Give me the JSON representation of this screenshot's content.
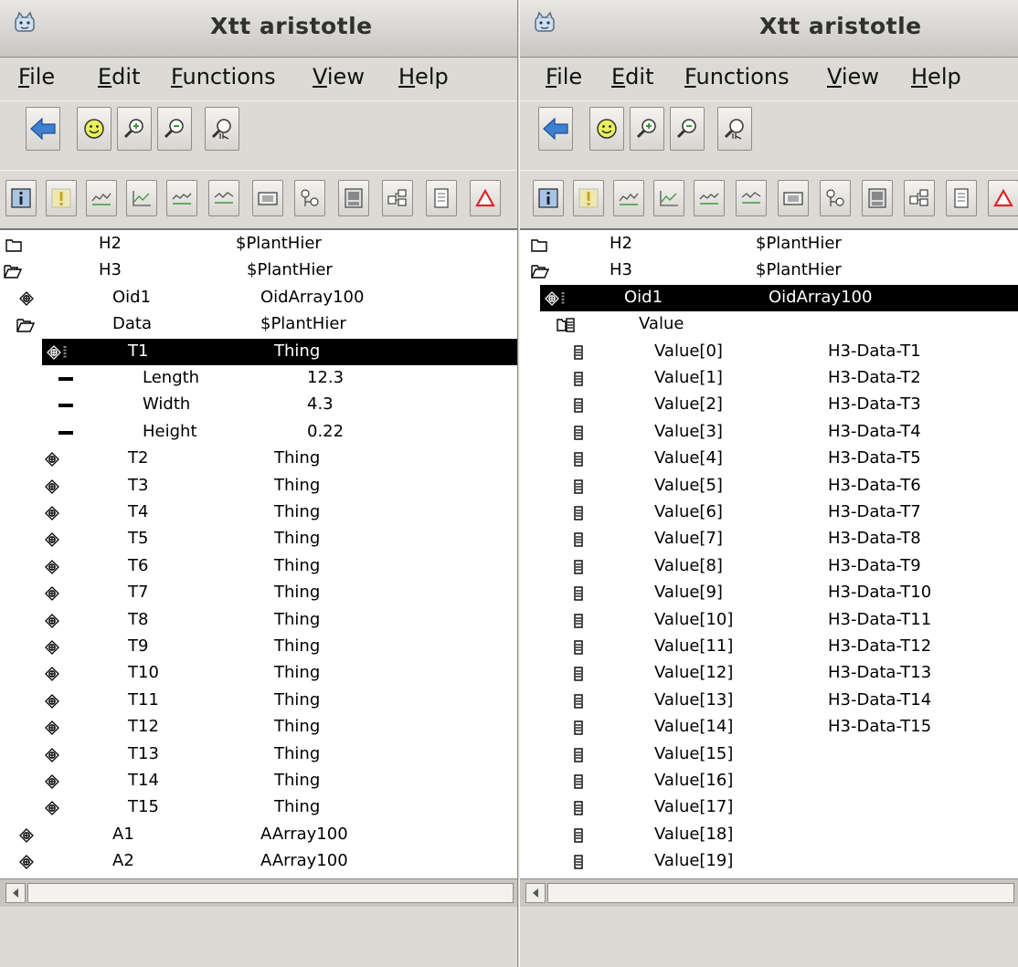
{
  "windows": [
    {
      "title": "Xtt aristotle",
      "menu": [
        {
          "first": "F",
          "rest": "ile"
        },
        {
          "first": "E",
          "rest": "dit"
        },
        {
          "first": "F",
          "rest": "unctions"
        },
        {
          "first": "V",
          "rest": "iew"
        },
        {
          "first": "H",
          "rest": "elp"
        }
      ],
      "rows": [
        {
          "icon": "folder-closed",
          "name": "H2",
          "value": "$PlantHier"
        },
        {
          "icon": "folder-open",
          "name": "H3",
          "value": "$PlantHier"
        },
        {
          "icon": "object",
          "name": "Oid1",
          "value": "OidArray100"
        },
        {
          "icon": "folder-open",
          "name": "Data",
          "value": "$PlantHier"
        },
        {
          "icon": "object-open",
          "name": "T1",
          "value": "Thing",
          "selected": true
        },
        {
          "icon": "attribute",
          "name": "Length",
          "value": "12.3"
        },
        {
          "icon": "attribute",
          "name": "Width",
          "value": "4.3"
        },
        {
          "icon": "attribute",
          "name": "Height",
          "value": "0.22"
        },
        {
          "icon": "object",
          "name": "T2",
          "value": "Thing"
        },
        {
          "icon": "object",
          "name": "T3",
          "value": "Thing"
        },
        {
          "icon": "object",
          "name": "T4",
          "value": "Thing"
        },
        {
          "icon": "object",
          "name": "T5",
          "value": "Thing"
        },
        {
          "icon": "object",
          "name": "T6",
          "value": "Thing"
        },
        {
          "icon": "object",
          "name": "T7",
          "value": "Thing"
        },
        {
          "icon": "object",
          "name": "T8",
          "value": "Thing"
        },
        {
          "icon": "object",
          "name": "T9",
          "value": "Thing"
        },
        {
          "icon": "object",
          "name": "T10",
          "value": "Thing"
        },
        {
          "icon": "object",
          "name": "T11",
          "value": "Thing"
        },
        {
          "icon": "object",
          "name": "T12",
          "value": "Thing"
        },
        {
          "icon": "object",
          "name": "T13",
          "value": "Thing"
        },
        {
          "icon": "object",
          "name": "T14",
          "value": "Thing"
        },
        {
          "icon": "object",
          "name": "T15",
          "value": "Thing"
        },
        {
          "icon": "object",
          "name": "A1",
          "value": "AArray100"
        },
        {
          "icon": "object",
          "name": "A2",
          "value": "AArray100"
        }
      ]
    },
    {
      "title": "Xtt aristotle",
      "menu": [
        {
          "first": "F",
          "rest": "ile"
        },
        {
          "first": "E",
          "rest": "dit"
        },
        {
          "first": "F",
          "rest": "unctions"
        },
        {
          "first": "V",
          "rest": "iew"
        },
        {
          "first": "H",
          "rest": "elp"
        }
      ],
      "rows": [
        {
          "icon": "folder-closed",
          "name": "H2",
          "value": "$PlantHier"
        },
        {
          "icon": "folder-open",
          "name": "H3",
          "value": "$PlantHier"
        },
        {
          "icon": "object-open",
          "name": "Oid1",
          "value": "OidArray100",
          "selected": true
        },
        {
          "icon": "array-open",
          "name": "Value",
          "value": ""
        },
        {
          "icon": "element",
          "name": "Value[0]",
          "value": "H3-Data-T1"
        },
        {
          "icon": "element",
          "name": "Value[1]",
          "value": "H3-Data-T2"
        },
        {
          "icon": "element",
          "name": "Value[2]",
          "value": "H3-Data-T3"
        },
        {
          "icon": "element",
          "name": "Value[3]",
          "value": "H3-Data-T4"
        },
        {
          "icon": "element",
          "name": "Value[4]",
          "value": "H3-Data-T5"
        },
        {
          "icon": "element",
          "name": "Value[5]",
          "value": "H3-Data-T6"
        },
        {
          "icon": "element",
          "name": "Value[6]",
          "value": "H3-Data-T7"
        },
        {
          "icon": "element",
          "name": "Value[7]",
          "value": "H3-Data-T8"
        },
        {
          "icon": "element",
          "name": "Value[8]",
          "value": "H3-Data-T9"
        },
        {
          "icon": "element",
          "name": "Value[9]",
          "value": "H3-Data-T10"
        },
        {
          "icon": "element",
          "name": "Value[10]",
          "value": "H3-Data-T11"
        },
        {
          "icon": "element",
          "name": "Value[11]",
          "value": "H3-Data-T12"
        },
        {
          "icon": "element",
          "name": "Value[12]",
          "value": "H3-Data-T13"
        },
        {
          "icon": "element",
          "name": "Value[13]",
          "value": "H3-Data-T14"
        },
        {
          "icon": "element",
          "name": "Value[14]",
          "value": "H3-Data-T15"
        },
        {
          "icon": "element",
          "name": "Value[15]",
          "value": ""
        },
        {
          "icon": "element",
          "name": "Value[16]",
          "value": ""
        },
        {
          "icon": "element",
          "name": "Value[17]",
          "value": ""
        },
        {
          "icon": "element",
          "name": "Value[18]",
          "value": ""
        },
        {
          "icon": "element",
          "name": "Value[19]",
          "value": ""
        }
      ]
    }
  ]
}
